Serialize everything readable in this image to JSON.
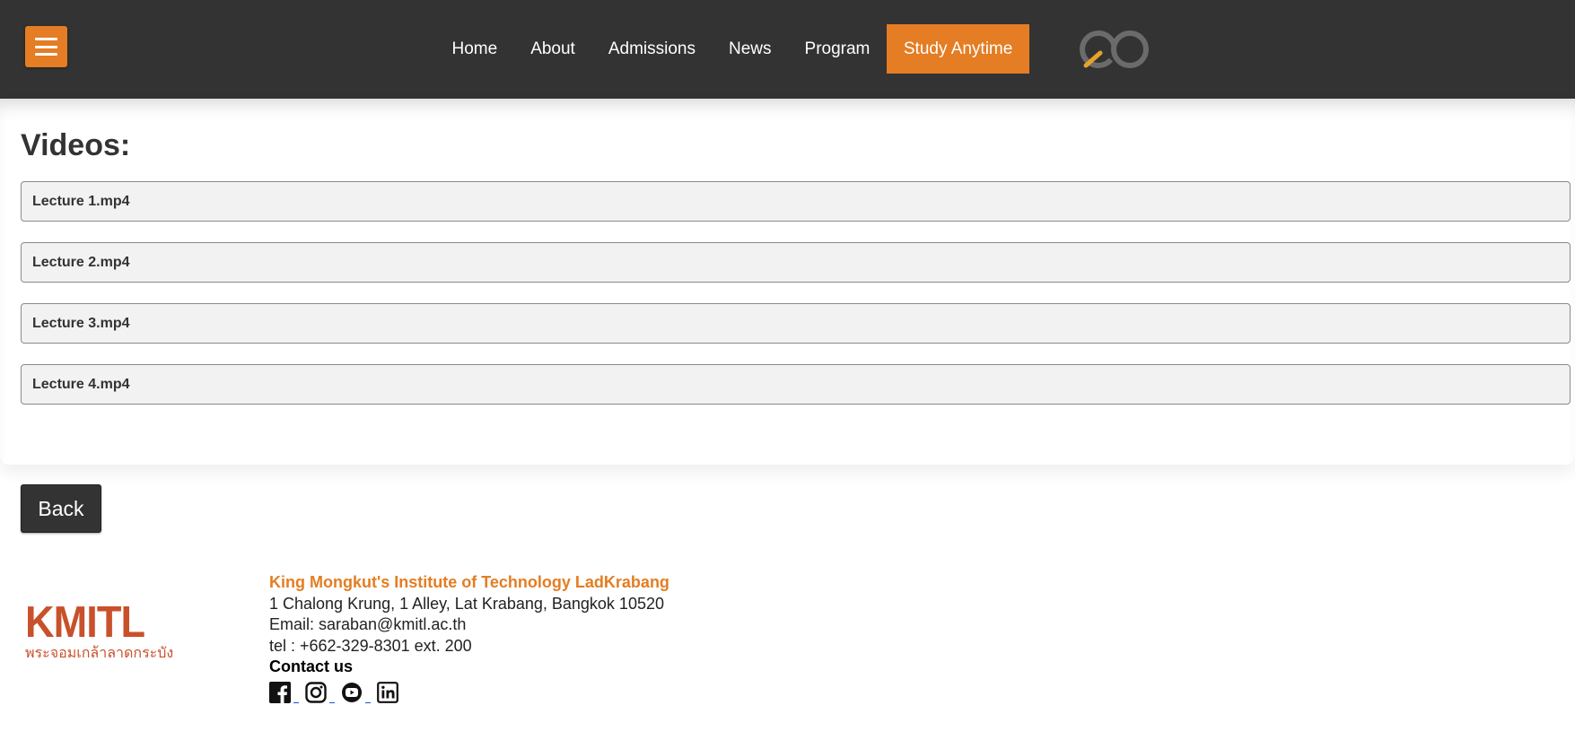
{
  "header": {
    "nav": [
      "Home",
      "About",
      "Admissions",
      "News",
      "Program",
      "Study Anytime"
    ],
    "active_index": 5,
    "accent_color": "#e47d23",
    "bg_color": "#333333",
    "menu_icon": "hamburger-icon",
    "logo_icon": "co-logo-icon"
  },
  "videos": {
    "heading": "Videos:",
    "items": [
      "Lecture 1.mp4",
      "Lecture 2.mp4",
      "Lecture 3.mp4",
      "Lecture 4.mp4"
    ]
  },
  "back_label": "Back",
  "footer": {
    "logo_text": "KMITL",
    "logo_subtitle": "พระจอมเกล้าลาดกระบัง",
    "institution": "King Mongkut's Institute of Technology LadKrabang",
    "address": "1 Chalong Krung, 1 Alley, Lat Krabang, Bangkok 10520",
    "email": "Email: saraban@kmitl.ac.th",
    "tel": "tel : +662-329-8301 ext. 200",
    "contact_label": "Contact us",
    "socials": [
      "facebook-icon",
      "instagram-icon",
      "youtube-icon",
      "linkedin-icon"
    ]
  }
}
